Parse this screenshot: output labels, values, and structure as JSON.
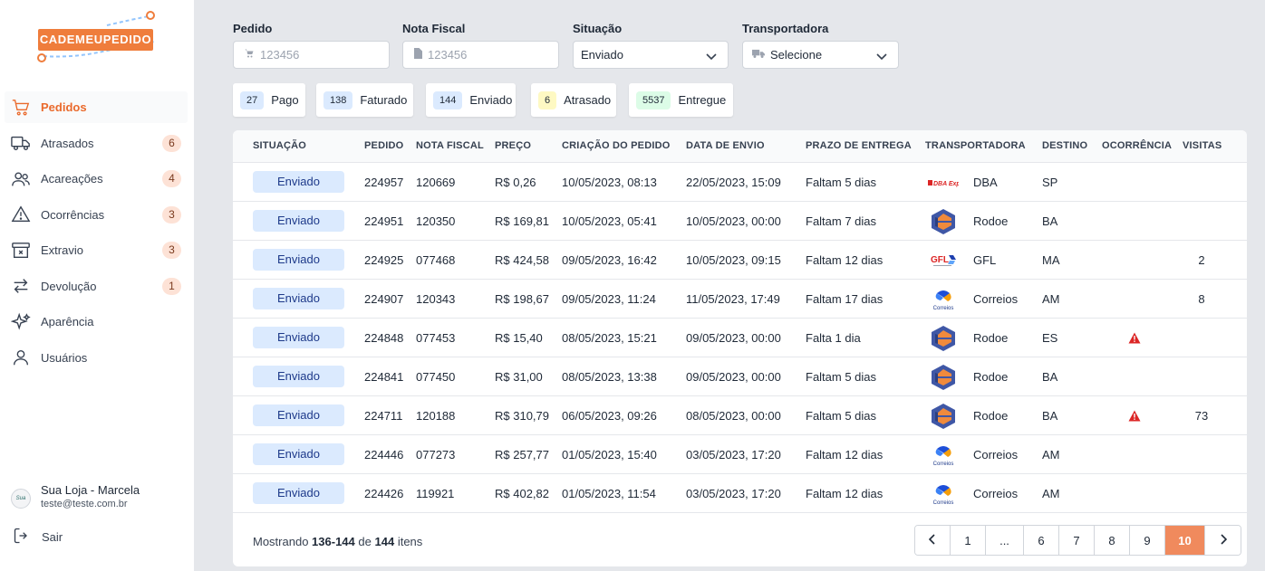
{
  "brand": {
    "logo_text": "CADEMEUPEDIDO",
    "accent": "#ef7d3c"
  },
  "sidebar": {
    "items": [
      {
        "label": "Pedidos",
        "icon": "cart-icon",
        "badge": "",
        "active": true
      },
      {
        "label": "Atrasados",
        "icon": "truck-icon",
        "badge": "6"
      },
      {
        "label": "Acareações",
        "icon": "users-icon",
        "badge": "4"
      },
      {
        "label": "Ocorrências",
        "icon": "alert-triangle-icon",
        "badge": "3"
      },
      {
        "label": "Extravio",
        "icon": "archive-x-icon",
        "badge": "3"
      },
      {
        "label": "Devolução",
        "icon": "arrows-swap-icon",
        "badge": "1"
      },
      {
        "label": "Aparência",
        "icon": "sparkles-icon",
        "badge": ""
      },
      {
        "label": "Usuários",
        "icon": "user-icon",
        "badge": ""
      }
    ],
    "user": {
      "name": "Sua Loja - Marcela",
      "email": "teste@teste.com.br",
      "avatar_text": "Sua Loja"
    },
    "logout_label": "Sair"
  },
  "filters": {
    "pedido": {
      "label": "Pedido",
      "placeholder": "123456"
    },
    "nota_fiscal": {
      "label": "Nota Fiscal",
      "placeholder": "123456"
    },
    "situacao": {
      "label": "Situação",
      "value": "Enviado"
    },
    "transportadora": {
      "label": "Transportadora",
      "value": "Selecione"
    }
  },
  "chips": [
    {
      "count": "27",
      "label": "Pago",
      "color": "#dbeafe"
    },
    {
      "count": "138",
      "label": "Faturado",
      "color": "#dbeafe"
    },
    {
      "count": "144",
      "label": "Enviado",
      "color": "#dbeafe"
    },
    {
      "count": "6",
      "label": "Atrasado",
      "color": "#fef9c3"
    },
    {
      "count": "5537",
      "label": "Entregue",
      "color": "#dcfce7"
    }
  ],
  "table": {
    "headers": [
      "SITUAÇÃO",
      "PEDIDO",
      "NOTA FISCAL",
      "PREÇO",
      "CRIAÇÃO DO PEDIDO",
      "DATA DE ENVIO",
      "PRAZO DE ENTREGA",
      "TRANSPORTADORA",
      "DESTINO",
      "OCORRÊNCIA",
      "VISITAS"
    ],
    "rows": [
      {
        "status": "Enviado",
        "pedido": "224957",
        "nf": "120669",
        "preco": "R$ 0,26",
        "criacao": "10/05/2023, 08:13",
        "envio": "22/05/2023, 15:09",
        "prazo": "Faltam 5 dias",
        "carrier": "DBA",
        "carrier_logo": "dba",
        "destino": "SP",
        "ocorrencia": false,
        "visitas": ""
      },
      {
        "status": "Enviado",
        "pedido": "224951",
        "nf": "120350",
        "preco": "R$ 169,81",
        "criacao": "10/05/2023, 05:41",
        "envio": "10/05/2023, 00:00",
        "prazo": "Faltam 7 dias",
        "carrier": "Rodoe",
        "carrier_logo": "rodoe",
        "destino": "BA",
        "ocorrencia": false,
        "visitas": ""
      },
      {
        "status": "Enviado",
        "pedido": "224925",
        "nf": "077468",
        "preco": "R$ 424,58",
        "criacao": "09/05/2023, 16:42",
        "envio": "10/05/2023, 09:15",
        "prazo": "Faltam 12 dias",
        "carrier": "GFL",
        "carrier_logo": "gfl",
        "destino": "MA",
        "ocorrencia": false,
        "visitas": "2"
      },
      {
        "status": "Enviado",
        "pedido": "224907",
        "nf": "120343",
        "preco": "R$ 198,67",
        "criacao": "09/05/2023, 11:24",
        "envio": "11/05/2023, 17:49",
        "prazo": "Faltam 17 dias",
        "carrier": "Correios",
        "carrier_logo": "correios",
        "destino": "AM",
        "ocorrencia": false,
        "visitas": "8"
      },
      {
        "status": "Enviado",
        "pedido": "224848",
        "nf": "077453",
        "preco": "R$ 15,40",
        "criacao": "08/05/2023, 15:21",
        "envio": "09/05/2023, 00:00",
        "prazo": "Falta 1 dia",
        "carrier": "Rodoe",
        "carrier_logo": "rodoe",
        "destino": "ES",
        "ocorrencia": true,
        "visitas": ""
      },
      {
        "status": "Enviado",
        "pedido": "224841",
        "nf": "077450",
        "preco": "R$ 31,00",
        "criacao": "08/05/2023, 13:38",
        "envio": "09/05/2023, 00:00",
        "prazo": "Faltam 5 dias",
        "carrier": "Rodoe",
        "carrier_logo": "rodoe",
        "destino": "BA",
        "ocorrencia": false,
        "visitas": ""
      },
      {
        "status": "Enviado",
        "pedido": "224711",
        "nf": "120188",
        "preco": "R$ 310,79",
        "criacao": "06/05/2023, 09:26",
        "envio": "08/05/2023, 00:00",
        "prazo": "Faltam 5 dias",
        "carrier": "Rodoe",
        "carrier_logo": "rodoe",
        "destino": "BA",
        "ocorrencia": true,
        "visitas": "73"
      },
      {
        "status": "Enviado",
        "pedido": "224446",
        "nf": "077273",
        "preco": "R$ 257,77",
        "criacao": "01/05/2023, 15:40",
        "envio": "03/05/2023, 17:20",
        "prazo": "Faltam 12 dias",
        "carrier": "Correios",
        "carrier_logo": "correios",
        "destino": "AM",
        "ocorrencia": false,
        "visitas": ""
      },
      {
        "status": "Enviado",
        "pedido": "224426",
        "nf": "119921",
        "preco": "R$ 402,82",
        "criacao": "01/05/2023, 11:54",
        "envio": "03/05/2023, 17:20",
        "prazo": "Faltam 12 dias",
        "carrier": "Correios",
        "carrier_logo": "correios",
        "destino": "AM",
        "ocorrencia": false,
        "visitas": ""
      }
    ]
  },
  "footer": {
    "prefix": "Mostrando",
    "range": "136-144",
    "middle": "de",
    "total": "144",
    "suffix": "itens"
  },
  "pagination": {
    "pages": [
      "1",
      "...",
      "6",
      "7",
      "8",
      "9",
      "10"
    ],
    "current": "10"
  }
}
